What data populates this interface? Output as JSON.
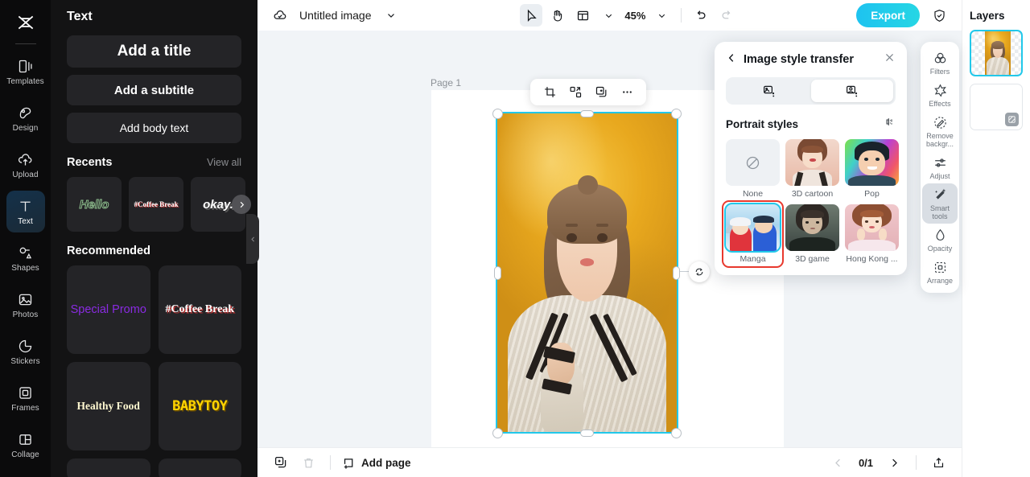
{
  "left_rail": {
    "logo": "capcut-logo",
    "items": [
      {
        "label": "Templates",
        "icon": "templates-icon",
        "active": false
      },
      {
        "label": "Design",
        "icon": "design-icon",
        "active": false
      },
      {
        "label": "Upload",
        "icon": "upload-cloud-icon",
        "active": false
      },
      {
        "label": "Text",
        "icon": "text-icon",
        "active": true
      },
      {
        "label": "Shapes",
        "icon": "shapes-icon",
        "active": false
      },
      {
        "label": "Photos",
        "icon": "photos-icon",
        "active": false
      },
      {
        "label": "Stickers",
        "icon": "stickers-icon",
        "active": false
      },
      {
        "label": "Frames",
        "icon": "frames-icon",
        "active": false
      },
      {
        "label": "Collage",
        "icon": "collage-icon",
        "active": false
      }
    ]
  },
  "text_panel": {
    "title": "Text",
    "buttons": {
      "add_title": "Add a title",
      "add_subtitle": "Add a subtitle",
      "add_body": "Add body text"
    },
    "recents": {
      "heading": "Recents",
      "view_all": "View all",
      "items": [
        {
          "text": "Hello",
          "style": "outline-green"
        },
        {
          "text": "#Coffee Break",
          "style": "serif-red-shadow"
        },
        {
          "text": "okay.",
          "style": "italic-white-shadow"
        }
      ]
    },
    "recommended": {
      "heading": "Recommended",
      "items": [
        {
          "text": "Special Promo",
          "style": "purple"
        },
        {
          "text": "#Coffee Break",
          "style": "serif-red-shadow"
        },
        {
          "text": "Healthy Food",
          "style": "cream-serif"
        },
        {
          "text": "BABYTOY",
          "style": "yellow-block"
        }
      ]
    }
  },
  "top_bar": {
    "cloud_status_icon": "cloud-check-icon",
    "document_title": "Untitled image",
    "title_chevron_icon": "chevron-down-icon",
    "tools": [
      {
        "name": "select-tool",
        "icon": "cursor-arrow-icon",
        "selected": true
      },
      {
        "name": "hand-tool",
        "icon": "hand-icon",
        "selected": false
      },
      {
        "name": "layout-tool",
        "icon": "layout-icon",
        "selected": false
      }
    ],
    "zoom_level": "45%",
    "undo_icon": "undo-arrow-icon",
    "redo_icon": "redo-arrow-icon",
    "export_label": "Export",
    "shield_icon": "shield-check-icon"
  },
  "stage": {
    "page_label": "Page 1",
    "float_toolbar": [
      {
        "name": "crop-button",
        "icon": "crop-icon"
      },
      {
        "name": "replace-button",
        "icon": "replace-icon"
      },
      {
        "name": "duplicate-button",
        "icon": "duplicate-icon"
      },
      {
        "name": "more-button",
        "icon": "ellipsis-icon"
      }
    ],
    "rotate_icon": "rotate-icon"
  },
  "style_panel": {
    "back_icon": "chevron-left-icon",
    "title": "Image style transfer",
    "close_icon": "close-x-icon",
    "tabs": [
      {
        "name": "image-style-tab",
        "icon": "image-style-icon",
        "active": false
      },
      {
        "name": "portrait-style-tab",
        "icon": "portrait-style-icon",
        "active": true
      }
    ],
    "section_heading": "Portrait styles",
    "compare_icon": "compare-icon",
    "styles": [
      {
        "label": "None",
        "selected": false,
        "kind": "none"
      },
      {
        "label": "3D cartoon",
        "selected": false,
        "kind": "cartoon"
      },
      {
        "label": "Pop",
        "selected": false,
        "kind": "pop"
      },
      {
        "label": "Manga",
        "selected": true,
        "kind": "manga"
      },
      {
        "label": "3D game",
        "selected": false,
        "kind": "game"
      },
      {
        "label": "Hong Kong ...",
        "selected": false,
        "kind": "hongkong"
      }
    ]
  },
  "tool_dock": {
    "items": [
      {
        "label": "Filters",
        "icon": "filters-icon",
        "active": false
      },
      {
        "label": "Effects",
        "icon": "effects-icon",
        "active": false
      },
      {
        "label": "Remove backgr...",
        "icon": "remove-background-icon",
        "active": false
      },
      {
        "label": "Adjust",
        "icon": "adjust-icon",
        "active": false
      },
      {
        "label": "Smart tools",
        "icon": "smart-tools-icon",
        "active": true
      },
      {
        "label": "Opacity",
        "icon": "opacity-icon",
        "active": false
      },
      {
        "label": "Arrange",
        "icon": "arrange-icon",
        "active": false
      }
    ]
  },
  "layers": {
    "title": "Layers",
    "items": [
      {
        "name": "layer-image",
        "selected": true,
        "kind": "image"
      },
      {
        "name": "layer-background",
        "selected": false,
        "kind": "blank"
      }
    ]
  },
  "bottom_bar": {
    "duplicate_page_icon": "duplicate-page-icon",
    "delete_page_icon": "trash-icon",
    "add_page_label": "Add page",
    "add_page_icon": "add-page-icon",
    "prev_icon": "chevron-left-icon",
    "page_count": "0/1",
    "next_icon": "chevron-right-icon",
    "export_page_icon": "upload-box-icon"
  },
  "colors": {
    "accent_cyan": "#22c8ea",
    "selection_red": "#e8392e",
    "canvas_bg": "#f1f4f7",
    "panel_dark": "#131314",
    "rail_dark": "#0b0b0c"
  }
}
